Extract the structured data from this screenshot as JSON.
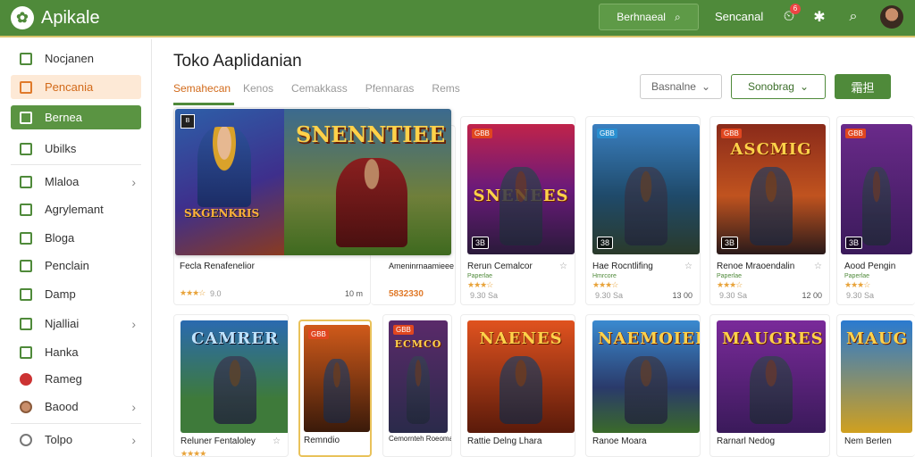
{
  "app": {
    "title": "Apikale",
    "search_label": "Berhnaeal",
    "link_label": "Sencanal",
    "notif_count": "6"
  },
  "sidebar": {
    "items": [
      {
        "label": "Nocjanen",
        "chev": ""
      },
      {
        "label": "Pencania",
        "chev": ""
      },
      {
        "label": "Bernea",
        "chev": ""
      },
      {
        "label": "Ubilks",
        "chev": ""
      },
      {
        "label": "Mlaloa",
        "chev": "›"
      },
      {
        "label": "Agrylemant",
        "chev": ""
      },
      {
        "label": "Bloga",
        "chev": ""
      },
      {
        "label": "Penclain",
        "chev": ""
      },
      {
        "label": "Damp",
        "chev": ""
      },
      {
        "label": "Njalliai",
        "chev": "›"
      },
      {
        "label": "Hanka",
        "chev": ""
      },
      {
        "label": "Rameg",
        "chev": ""
      },
      {
        "label": "Baood",
        "chev": "›"
      },
      {
        "label": "Tolpo",
        "chev": "›"
      }
    ]
  },
  "main": {
    "title": "Toko Aaplidanian",
    "tabs": [
      "Semahecan",
      "Kenos",
      "Cemakkass",
      "Pfennaras",
      "Rems"
    ],
    "filter_label": "Basnalne",
    "sort_label": "Sonobrag",
    "apply_label": "霜担"
  },
  "featured": {
    "badge": "B",
    "title_left": "SKGENKRIS",
    "title_right": "SNENNTIEE",
    "name_left": "Fecla Renafenelior",
    "name_right": "Ameninrnaamieee",
    "stars": "★★★☆",
    "rate": "9.0",
    "size": "10 m",
    "price": "5832330"
  },
  "cards": [
    {
      "name": "Rerun Cemalcor",
      "banner": "SNENEES",
      "tag": "GBB",
      "num": "3B",
      "dev": "Paperlae",
      "stars": "★★★☆",
      "rate": "9.30 Sa",
      "size": "",
      "price": ""
    },
    {
      "name": "Hae Rocntlifing",
      "banner": "",
      "tag": "GBB",
      "num": "38",
      "dev": "Hmrcore",
      "stars": "★★★☆",
      "rate": "9.30 Sa",
      "size": "13 00",
      "price": ""
    },
    {
      "name": "Renoe Mraoendalin",
      "banner": "ASCMIG",
      "tag": "GBB",
      "num": "3B",
      "dev": "Paperlae",
      "stars": "★★★☆",
      "rate": "9.30 Sa",
      "size": "12 00",
      "price": ""
    },
    {
      "name": "Aood Pengin",
      "banner": "",
      "tag": "GBB",
      "num": "3B",
      "dev": "Paperlae",
      "stars": "★★★☆",
      "rate": "9.30 Sa",
      "size": "",
      "price": ""
    },
    {
      "name": "Reluner Fentaloley",
      "banner": "CAMRER",
      "tag": "",
      "num": "",
      "dev": "",
      "stars": "★★★★",
      "rate": "",
      "size": "",
      "price": ""
    },
    {
      "name": "Remndio",
      "banner": "",
      "tag": "GBB",
      "num": "",
      "dev": "",
      "stars": "",
      "rate": "",
      "size": "",
      "price": ""
    },
    {
      "name": "Cemornteh Roeomasi",
      "banner": "ECMCO",
      "tag": "GBB",
      "num": "",
      "dev": "",
      "stars": "",
      "rate": "",
      "size": "",
      "price": ""
    },
    {
      "name": "Rattie Delng Lhara",
      "banner": "NAENES",
      "tag": "",
      "num": "",
      "dev": "",
      "stars": "",
      "rate": "",
      "size": "",
      "price": ""
    },
    {
      "name": "Ranoe Moara",
      "banner": "NAEMOIER",
      "tag": "",
      "num": "",
      "dev": "",
      "stars": "",
      "rate": "",
      "size": "",
      "price": ""
    },
    {
      "name": "Rarnarl Nedog",
      "banner": "MAUGRES",
      "tag": "",
      "num": "",
      "dev": "",
      "stars": "",
      "rate": "",
      "size": "",
      "price": ""
    },
    {
      "name": "Nem Berlen",
      "banner": "MAUG",
      "tag": "",
      "num": "",
      "dev": "",
      "stars": "",
      "rate": "",
      "size": "",
      "price": ""
    }
  ],
  "colors": {
    "brand": "#4f8a3a",
    "accent": "#e07a2a"
  }
}
